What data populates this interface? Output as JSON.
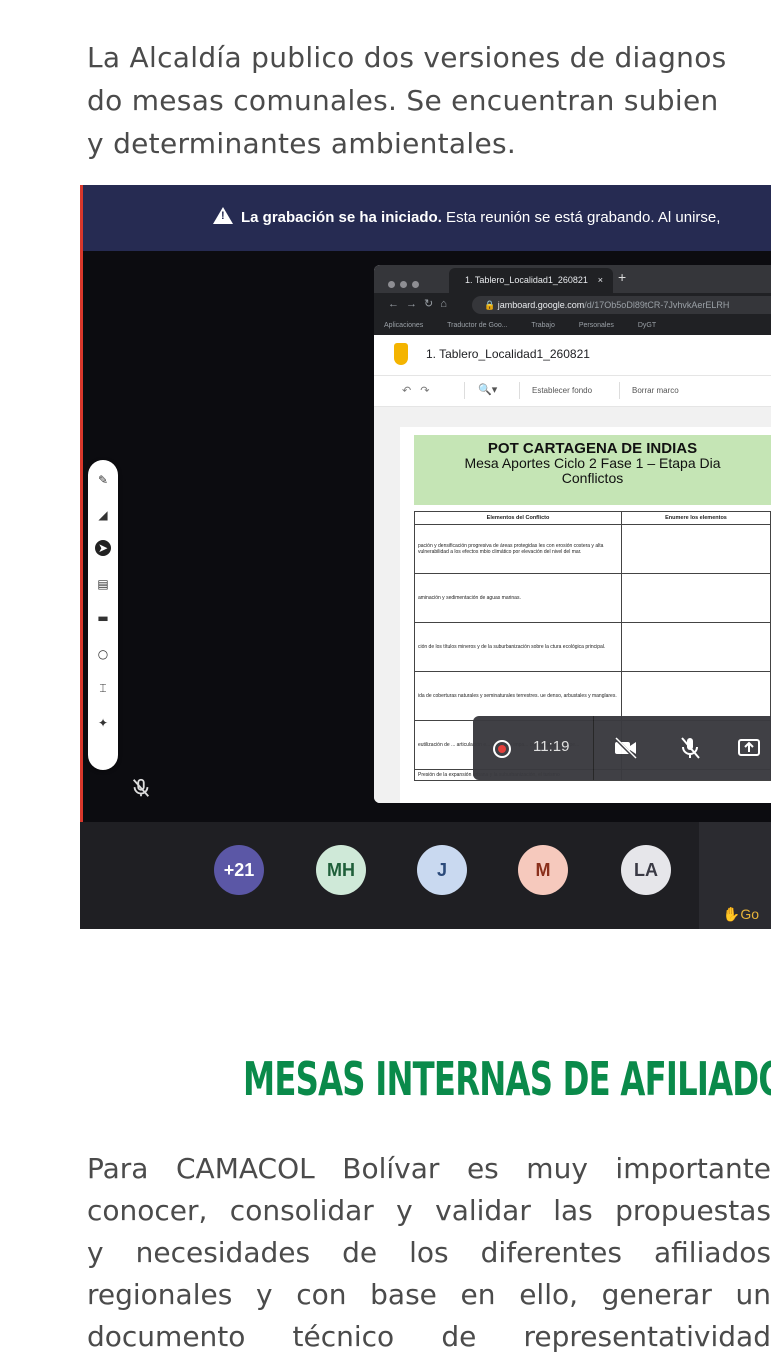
{
  "intro": {
    "lines": [
      "La Alcaldía publico dos versiones de diagnos",
      "do mesas comunales. Se encuentran subien",
      "y determinantes ambientales."
    ]
  },
  "meeting": {
    "banner_bold": "La grabación se ha iniciado.",
    "banner_text": " Esta reunión se está grabando. Al unirse,",
    "browser": {
      "tab_title": "1. Tablero_Localidad1_260821",
      "tab_close": "×",
      "new_tab": "+",
      "url_host": "jamboard.google.com",
      "url_path": "/d/17Ob5oDl89tCR-7JvhvkAerELRH",
      "bookmarks": [
        "Aplicaciones",
        "Traductor de Goo...",
        "Trabajo",
        "Personales",
        "DyGT"
      ],
      "board_name": "1. Tablero_Localidad1_260821",
      "set_background": "Establecer fondo",
      "clear_frame": "Borrar marco"
    },
    "board": {
      "title": "POT CARTAGENA DE INDIAS",
      "subtitle": "Mesa Aportes Ciclo 2 Fase 1 – Etapa Dia",
      "subtitle2": "Conflictos",
      "col1": "Elementos del Conflicto",
      "col2": "Enumere los elementos",
      "rows": [
        "pación y densificación progresiva de áreas protegidas les con erosión costera y alta vulnerabilidad a los efectos mbio climático por elevación del nivel del mar.",
        "aminación y sedimentación de aguas marinas.",
        "ción de los títulos mineros y de la suburbanización sobre la ctura ecológica principal.",
        "ida de coberturas naturales y seminaturales terrestres. ue denso, arbustales y manglares.",
        "eutilización de ... articulación e... ados con impa... como agricultura, pe...",
        "Presión de la expansión urbana y la suburbanización, el turismo"
      ]
    },
    "call_time": "11:19",
    "participants": [
      {
        "initials": "+21",
        "bg": "#5b57a6",
        "fg": "#ffffff"
      },
      {
        "initials": "MH",
        "bg": "#cfe9d8",
        "fg": "#1f5f3a"
      },
      {
        "initials": "J",
        "bg": "#c9d9f0",
        "fg": "#2b4a7a"
      },
      {
        "initials": "M",
        "bg": "#f6c9bd",
        "fg": "#8a2f1b"
      },
      {
        "initials": "LA",
        "bg": "#e6e6ea",
        "fg": "#3a3a45"
      }
    ],
    "hand_label": "Go"
  },
  "section": {
    "heading": "MESAS INTERNAS DE AFILIADO",
    "lines": [
      "Para CAMACOL Bolívar es muy importante",
      "conocer, consolidar y validar las propuestas",
      "y necesidades de los diferentes afiliados",
      "regionales y con base en ello, generar un",
      "documento técnico de representatividad"
    ]
  },
  "colors": {
    "heading_green": "#0a8a4a",
    "banner_navy": "#262b52"
  }
}
